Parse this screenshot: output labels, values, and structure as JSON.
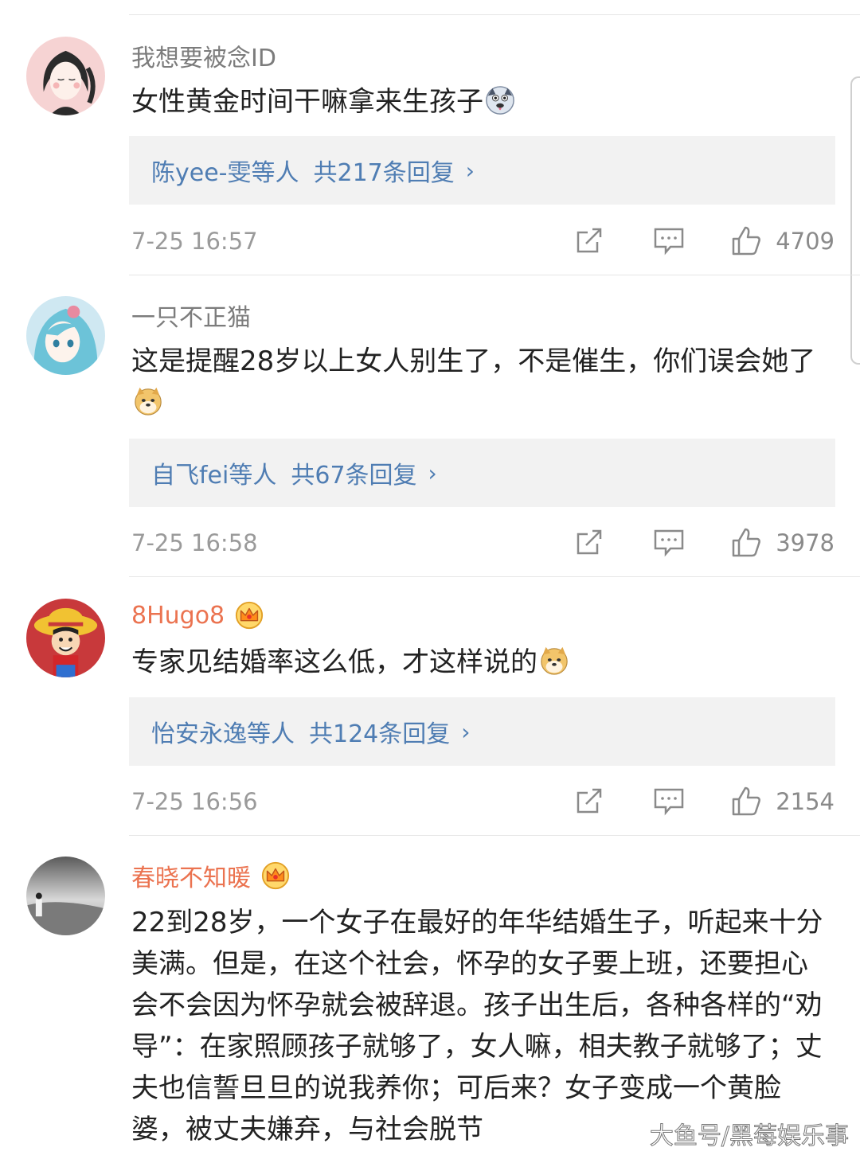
{
  "comments": [
    {
      "username": "我想要被念ID",
      "vip": false,
      "text": "女性黄金时间干嘛拿来生孩子",
      "emoji": "husky-dog-emoji",
      "reply_names": "陈yee-雯",
      "reply_etc": "等人",
      "reply_count": "共217条回复",
      "time": "7-25 16:57",
      "likes": "4709"
    },
    {
      "username": "一只不正猫",
      "vip": false,
      "text": "这是提醒28岁以上女人别生了，不是催生，你们误会她了",
      "emoji": "doge-emoji",
      "reply_names": "自飞fei",
      "reply_etc": "等人",
      "reply_count": "共67条回复",
      "time": "7-25 16:58",
      "likes": "3978"
    },
    {
      "username": "8Hugo8",
      "vip": true,
      "text": "专家见结婚率这么低，才这样说的",
      "emoji": "doge-emoji",
      "reply_names": "怡安永逸",
      "reply_etc": "等人",
      "reply_count": "共124条回复",
      "time": "7-25 16:56",
      "likes": "2154"
    },
    {
      "username": "春晓不知暖",
      "vip": true,
      "text": "22到28岁，一个女子在最好的年华结婚生子，听起来十分美满。但是，在这个社会，怀孕的女子要上班，还要担心会不会因为怀孕就会被辞退。孩子出生后，各种各样的“劝导”：在家照顾孩子就够了，女人嘛，相夫教子就够了；丈夫也信誓旦旦的说我养你；可后来？女子变成一个黄脸婆，被丈夫嫌弃，与社会脱节"
    }
  ],
  "chevron": "›",
  "watermark": "大鱼号/黑莓娱乐事",
  "colors": {
    "link": "#4f7db3",
    "vip_name": "#eb7350",
    "reply_bg": "#f2f2f2",
    "meta_text": "#9a9a9a"
  }
}
